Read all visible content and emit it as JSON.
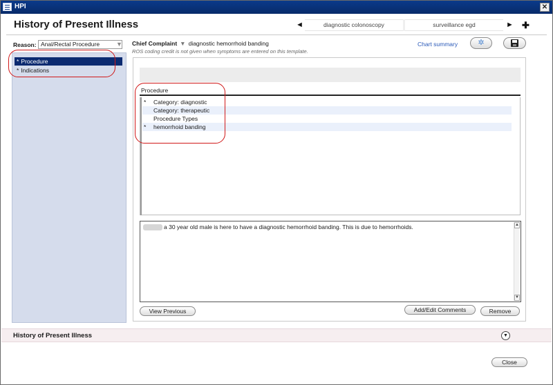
{
  "window": {
    "title": "HPI",
    "close_glyph": "✕"
  },
  "header": {
    "title": "History of Present Illness",
    "tabs": [
      "diagnostic colonoscopy",
      "surveillance egd"
    ],
    "prev_arrow": "◄",
    "next_arrow": "►",
    "add_glyph": "✚"
  },
  "left": {
    "reason_label": "Reason:",
    "reason_value": "Anal/Rectal Procedure",
    "reason_caret": "▼",
    "tree": [
      {
        "star": "*",
        "label": "Procedure",
        "selected": true
      },
      {
        "star": "*",
        "label": "Indications",
        "selected": false
      }
    ]
  },
  "right": {
    "chief_complaint_label": "Chief Complaint",
    "chief_complaint_caret": "▼",
    "chief_complaint_value": "diagnostic hemorrhoid banding",
    "ros_note": "ROS coding credit is not given when symptoms are entered on this template.",
    "chart_summary": "Chart summary",
    "spinner_glyph": "✲",
    "procedure_header": "Procedure",
    "procedure_rows": [
      {
        "star": "*",
        "label": "Category: diagnostic",
        "alt": false
      },
      {
        "star": "",
        "label": "Category: therapeutic",
        "alt": true
      },
      {
        "star": "",
        "label": "Procedure Types",
        "alt": false
      },
      {
        "star": "*",
        "label": "hemorrhoid banding",
        "alt": true
      }
    ],
    "narrative": "a 30 year old male is here to have a diagnostic hemorrhoid banding. This is due to hemorrhoids.",
    "scroll_up": "▲",
    "scroll_down": "▼",
    "view_previous": "View Previous",
    "add_edit_comments": "Add/Edit Comments",
    "remove": "Remove"
  },
  "footer": {
    "section_label": "History of Present Illness",
    "expand_glyph": "▼",
    "close": "Close"
  },
  "colors": {
    "title_bar": "#0a3a8a",
    "selected_item": "#0b2a70",
    "tree_bg": "#d5dcec",
    "annotation_circle": "#d01818",
    "link": "#2a59b8"
  }
}
